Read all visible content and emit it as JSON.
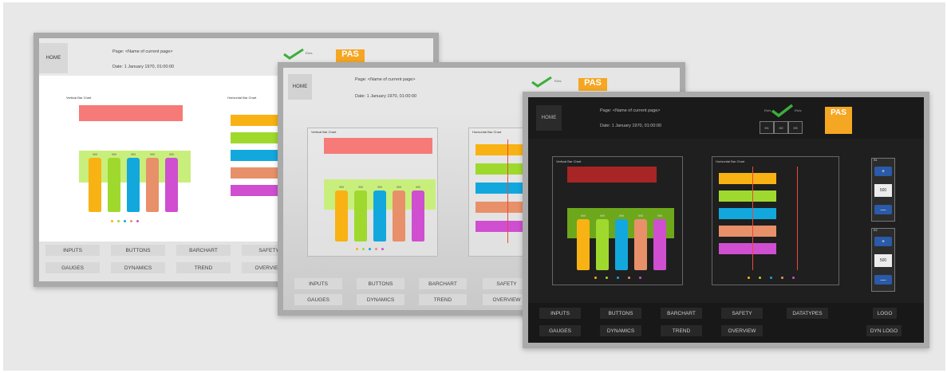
{
  "screens": [
    {
      "theme": "light",
      "header": {
        "home_label": "HOME",
        "page_label": "Page: <Name of current page>",
        "date_label": "Date: 1 January 1970, 01:00:00",
        "logo_label": "PAS",
        "brand_text": "Elvis"
      },
      "vertical_chart": {
        "title": "Vertical Bar Chart",
        "bar_labels": [
          "999",
          "999",
          "999",
          "999",
          "999"
        ]
      },
      "horizontal_chart": {
        "title": "Horizontal Bar Chart"
      },
      "nav": {
        "row1": [
          "INPUTS",
          "BUTTONS",
          "BARCHART",
          "SAFETY"
        ],
        "row2": [
          "GAUGES",
          "DYNAMICS",
          "TREND",
          "OVERVIEW"
        ]
      }
    },
    {
      "theme": "light",
      "header": {
        "home_label": "HOME",
        "page_label": "Page: <Name of current page>",
        "date_label": "Date: 1 January 1970, 01:00:00",
        "logo_label": "PAS",
        "brand_text": "Elvis"
      },
      "vertical_chart": {
        "title": "Vertical Bar Chart",
        "bar_labels": [
          "999",
          "999",
          "999",
          "999",
          "999"
        ]
      },
      "horizontal_chart": {
        "title": "Horizontal Bar Chart"
      },
      "nav": {
        "row1": [
          "INPUTS",
          "BUTTONS",
          "BARCHART",
          "SAFETY"
        ],
        "row2": [
          "GAUGES",
          "DYNAMICS",
          "TREND",
          "OVERVIEW"
        ]
      }
    },
    {
      "theme": "dark",
      "header": {
        "home_label": "HOME",
        "page_label": "Page: <Name of current page>",
        "date_label": "Date: 1 January 1970, 01:00:00",
        "logo_label": "PAS",
        "brand_text": "Elvis"
      },
      "vertical_chart": {
        "title": "Vertical Bar Chart",
        "bar_labels": [
          "999",
          "999",
          "999",
          "999",
          "999"
        ]
      },
      "horizontal_chart": {
        "title": "Horizontal Bar Chart"
      },
      "side_controls": [
        {
          "label": "B1",
          "value": "500",
          "plus": "+",
          "minus": "—"
        },
        {
          "label": "B2",
          "value": "500",
          "plus": "+",
          "minus": "—"
        }
      ],
      "header_boxes": [
        "H1",
        "H2",
        "H3"
      ],
      "nav": {
        "row1": [
          "INPUTS",
          "BUTTONS",
          "BARCHART",
          "SAFETY",
          "DATATYPES",
          "LOGO"
        ],
        "row2": [
          "GAUGES",
          "DYNAMICS",
          "TREND",
          "OVERVIEW",
          "DYN LOGO"
        ]
      }
    }
  ],
  "colors": {
    "bars": [
      "#f9b213",
      "#9fd92e",
      "#12a8de",
      "#e8906a",
      "#cf4fd0"
    ],
    "limit_band": "#c8ef7c",
    "alarm_band": "#f57a78",
    "alarm_band_dark": "#a82525",
    "logo": "#f5a623",
    "check": "#3cae3c"
  }
}
